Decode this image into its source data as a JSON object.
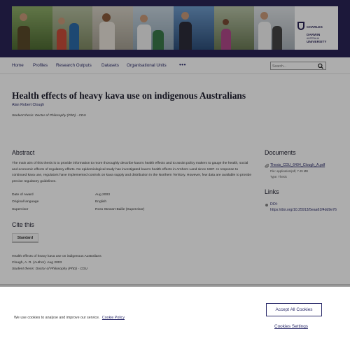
{
  "header": {
    "logo": {
      "line1": "CHARLES",
      "line2": "DARWIN",
      "line3": "UNIVERSITY",
      "sub": "AUSTRALIA"
    }
  },
  "nav": {
    "items": [
      "Home",
      "Profiles",
      "Research Outputs",
      "Datasets",
      "Organisational Units"
    ],
    "more": "•••"
  },
  "search": {
    "placeholder": "Search..."
  },
  "main": {
    "title": "Health effects of heavy kava use on indigenous Australians",
    "author": "Alan Robert Clough",
    "thesis_type": "Student thesis: Doctor of Philosophy (PhD) - CDU",
    "abstract_heading": "Abstract",
    "abstract_text": "The main aim of this thesis is to provide information to more thoroughly describe kava's health effects and to assist policy makers to gauge the health, social and economic effects of regulatory efforts. No epidemiological study has investigated kava's health effects in Arnhem Land since 1987. In response to continued kava use, regulators have implemented controls on kava supply and distribution in the Northern Territory. However, few data are available to provide precise regulatory guidelines.",
    "meta": [
      {
        "key": "Date of Award",
        "value": "Aug 2003"
      },
      {
        "key": "Original language",
        "value": "English"
      },
      {
        "key": "Supervisor",
        "value": "Ross Stewart Bailie (Supervisor)"
      }
    ],
    "cite_heading": "Cite this",
    "cite_tab": "Standard",
    "citation": {
      "title": "Health effects of heavy kava use on indigenous Australians",
      "author": "Clough, A. R. (Author). Aug 2003",
      "type": "Student thesis: Doctor of Philosophy (PhD) - CDU"
    }
  },
  "sidebar": {
    "documents_heading": "Documents",
    "document": {
      "name": "Thesis_CDU_6404_Clough_A.pdf",
      "file_info": "File: application/pdf, 7.49 MB",
      "type_info": "Type: Thesis"
    },
    "links_heading": "Links",
    "link": {
      "label": "DOI:",
      "url": "https://doi.org/10.25913/5eaa61f4dd9e76"
    }
  },
  "cookie": {
    "message": "We use cookies to analyse and improve our service.",
    "policy_link": "Cookie Policy",
    "accept": "Accept All Cookies",
    "settings": "Cookies Settings"
  },
  "colors": {
    "brand": "#2a2456",
    "link": "#2b2b6a"
  }
}
